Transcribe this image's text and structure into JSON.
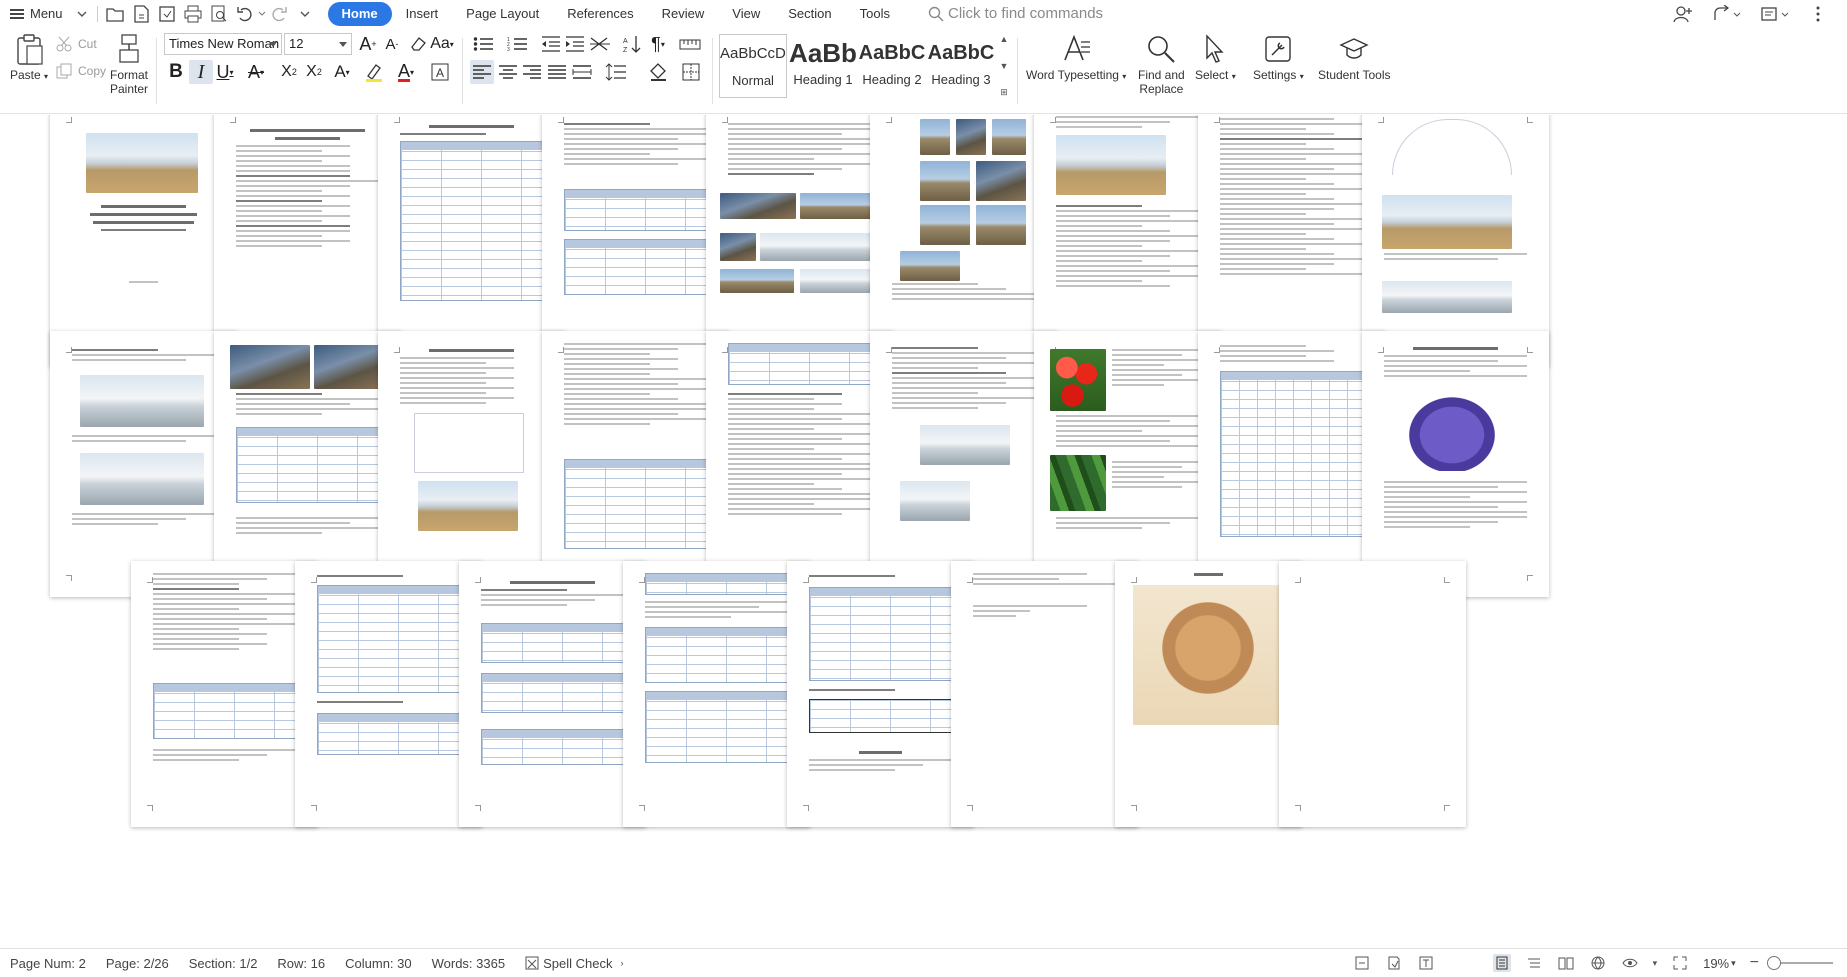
{
  "menubar": {
    "menu_label": "Menu",
    "tabs": [
      {
        "label": "Home",
        "active": true
      },
      {
        "label": "Insert",
        "active": false
      },
      {
        "label": "Page Layout",
        "active": false
      },
      {
        "label": "References",
        "active": false
      },
      {
        "label": "Review",
        "active": false
      },
      {
        "label": "View",
        "active": false
      },
      {
        "label": "Section",
        "active": false
      },
      {
        "label": "Tools",
        "active": false
      }
    ],
    "search_placeholder": "Click to find commands"
  },
  "ribbon": {
    "paste": "Paste",
    "cut": "Cut",
    "copy": "Copy",
    "format_painter": "Format\nPainter",
    "font_name": "Times New Roman",
    "font_size": "12",
    "styles": [
      {
        "preview": "AaBbCcDd",
        "name": "Normal"
      },
      {
        "preview": "AaBb",
        "name": "Heading 1"
      },
      {
        "preview": "AaBbC",
        "name": "Heading 2"
      },
      {
        "preview": "AaBbC",
        "name": "Heading 3"
      }
    ],
    "word_typesetting": "Word Typesetting",
    "find_replace": "Find and\nReplace",
    "select": "Select",
    "settings": "Settings",
    "student_tools": "Student Tools"
  },
  "statusbar": {
    "page_num": "Page Num: 2",
    "page": "Page: 2/26",
    "section": "Section: 1/2",
    "row": "Row: 16",
    "column": "Column: 30",
    "words": "Words: 3365",
    "spell_check": "Spell Check",
    "zoom": "19%"
  },
  "colors": {
    "accent": "#2b78e4",
    "table_header": "#b7c7de"
  }
}
